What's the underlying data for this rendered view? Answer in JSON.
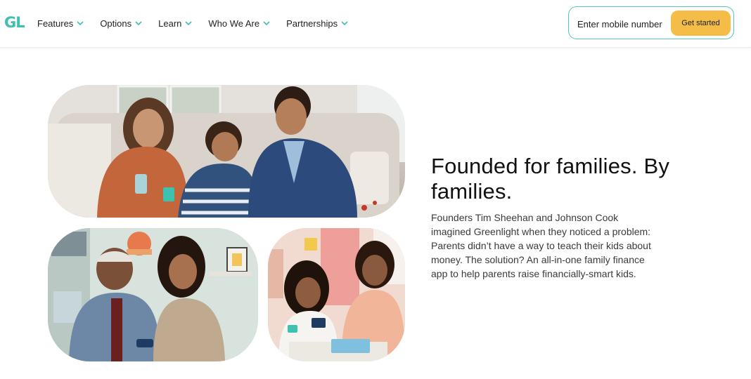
{
  "header": {
    "logo": "GL",
    "nav": [
      {
        "label": "Features"
      },
      {
        "label": "Options"
      },
      {
        "label": "Learn"
      },
      {
        "label": "Who We Are"
      },
      {
        "label": "Partnerships"
      }
    ],
    "signup": {
      "placeholder": "Enter mobile number",
      "button_label": "Get started"
    }
  },
  "colors": {
    "brand_teal": "#3fbfb1",
    "cta_yellow": "#f4bd48"
  },
  "main": {
    "headline": "Founded for families. By families.",
    "body": "Founders Tim Sheehan and Johnson Cook imagined Greenlight when they noticed a problem: Parents didn’t have a way to teach their kids about money. The solution? An all-in-one family finance app to help parents raise financially-smart kids."
  }
}
